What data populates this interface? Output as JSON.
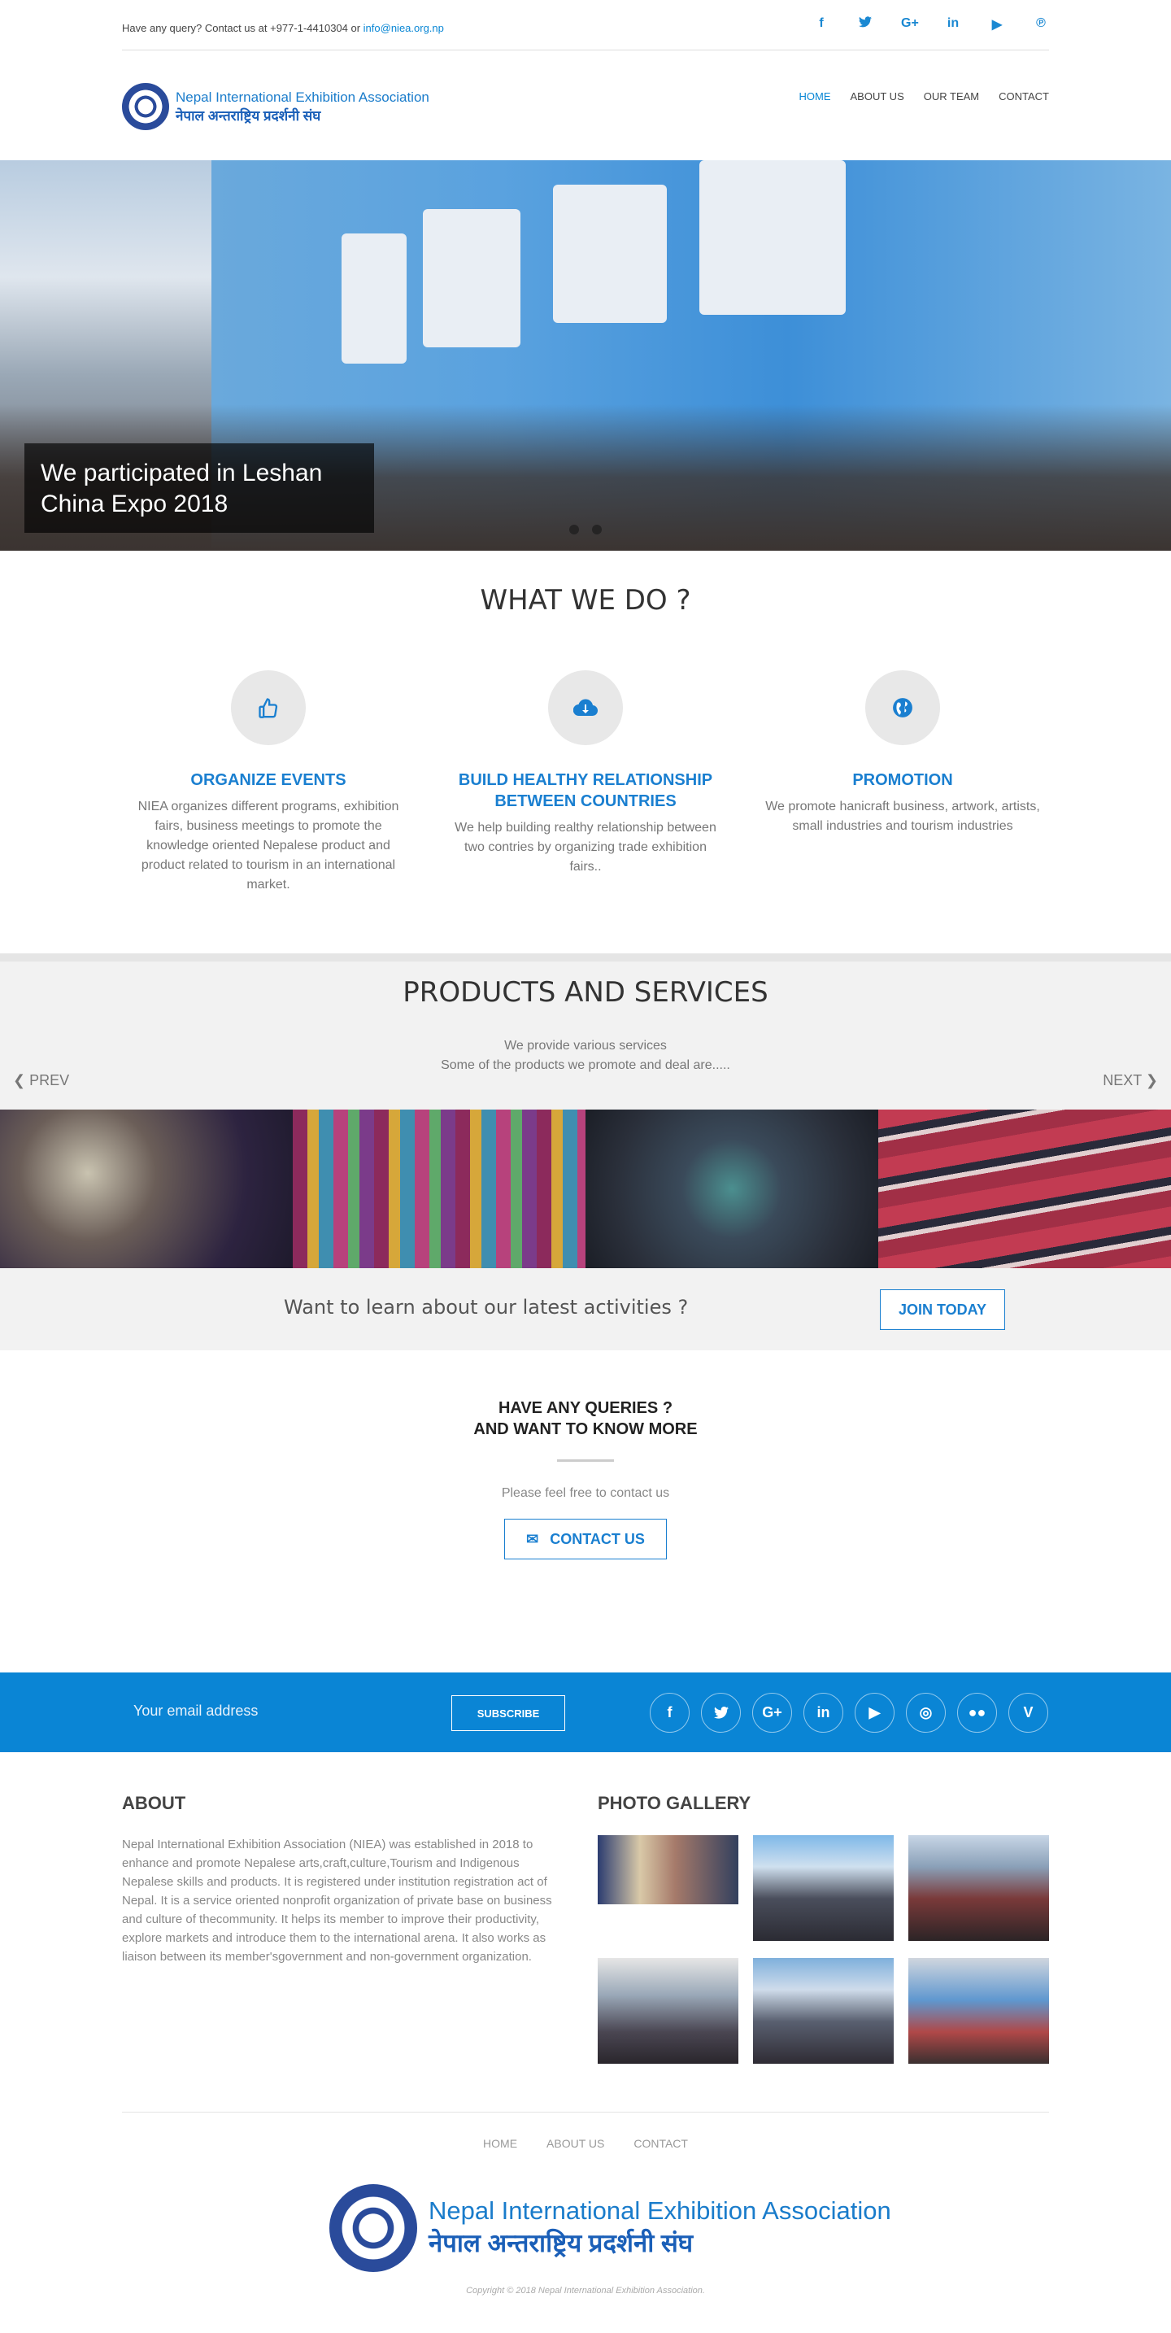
{
  "topbar": {
    "query_text": "Have any query? Contact us at +977-1-4410304 or ",
    "email": "info@niea.org.np",
    "socials": [
      "facebook-icon",
      "twitter-icon",
      "google-plus-icon",
      "linkedin-icon",
      "youtube-icon",
      "pinterest-icon"
    ]
  },
  "logo": {
    "name_en": "Nepal International Exhibition Association",
    "name_np": "नेपाल अन्तराष्ट्रिय प्रदर्शनी संघ"
  },
  "nav": {
    "items": [
      "HOME",
      "ABOUT US",
      "OUR TEAM",
      "CONTACT"
    ],
    "active": "HOME"
  },
  "hero": {
    "caption": "We participated in Leshan China Expo 2018"
  },
  "what_we_do": {
    "title": "WHAT WE DO ?",
    "features": [
      {
        "icon": "thumbs-up-icon",
        "title": "ORGANIZE EVENTS",
        "text": "NIEA organizes different programs, exhibition fairs, business meetings to promote the knowledge oriented Nepalese product and product related to tourism in an international market."
      },
      {
        "icon": "cloud-download-icon",
        "title": "BUILD HEALTHY RELATIONSHIP BETWEEN COUNTRIES",
        "text": "We help building realthy relationship between two contries by organizing trade exhibition fairs.."
      },
      {
        "icon": "globe-icon",
        "title": "PROMOTION",
        "text": "We promote hanicraft business, artwork, artists, small industries and tourism industries"
      }
    ]
  },
  "products": {
    "title": "PRODUCTS AND SERVICES",
    "subtitle_1": "We provide various services",
    "subtitle_2": "Some of the products we promote and deal are.....",
    "prev": "PREV",
    "next": "NEXT"
  },
  "join": {
    "text": "Want to learn about our latest activities ?",
    "button": "JOIN TODAY"
  },
  "queries": {
    "line1": "HAVE ANY QUERIES ?",
    "line2": "AND WANT TO KNOW MORE",
    "text": "Please feel free to contact us",
    "button": "CONTACT US"
  },
  "subscribe": {
    "placeholder": "Your email address",
    "button": "SUBSCRIBE",
    "socials": [
      "facebook-icon",
      "twitter-icon",
      "google-plus-icon",
      "linkedin-icon",
      "youtube-icon",
      "instagram-icon",
      "flickr-icon",
      "vimeo-icon"
    ]
  },
  "about": {
    "title": "ABOUT",
    "text": "Nepal International Exhibition Association (NIEA) was established in 2018 to enhance and promote Nepalese arts,craft,culture,Tourism and Indigenous Nepalese skills and products. It is registered under institution registration act of Nepal. It is a service oriented nonprofit organization of private base on business and culture of thecommunity. It helps its member to improve their productivity, explore markets and introduce them to the international arena. It also works as liaison between its member'sgovernment and non-government organization."
  },
  "gallery": {
    "title": "PHOTO GALLERY"
  },
  "footer": {
    "nav": [
      "HOME",
      "ABOUT US",
      "CONTACT"
    ],
    "copyright": "Copyright © 2018 Nepal International Exhibition Association."
  },
  "colors": {
    "accent": "#0a87d5",
    "subscribe_bg": "#0a85d5"
  }
}
